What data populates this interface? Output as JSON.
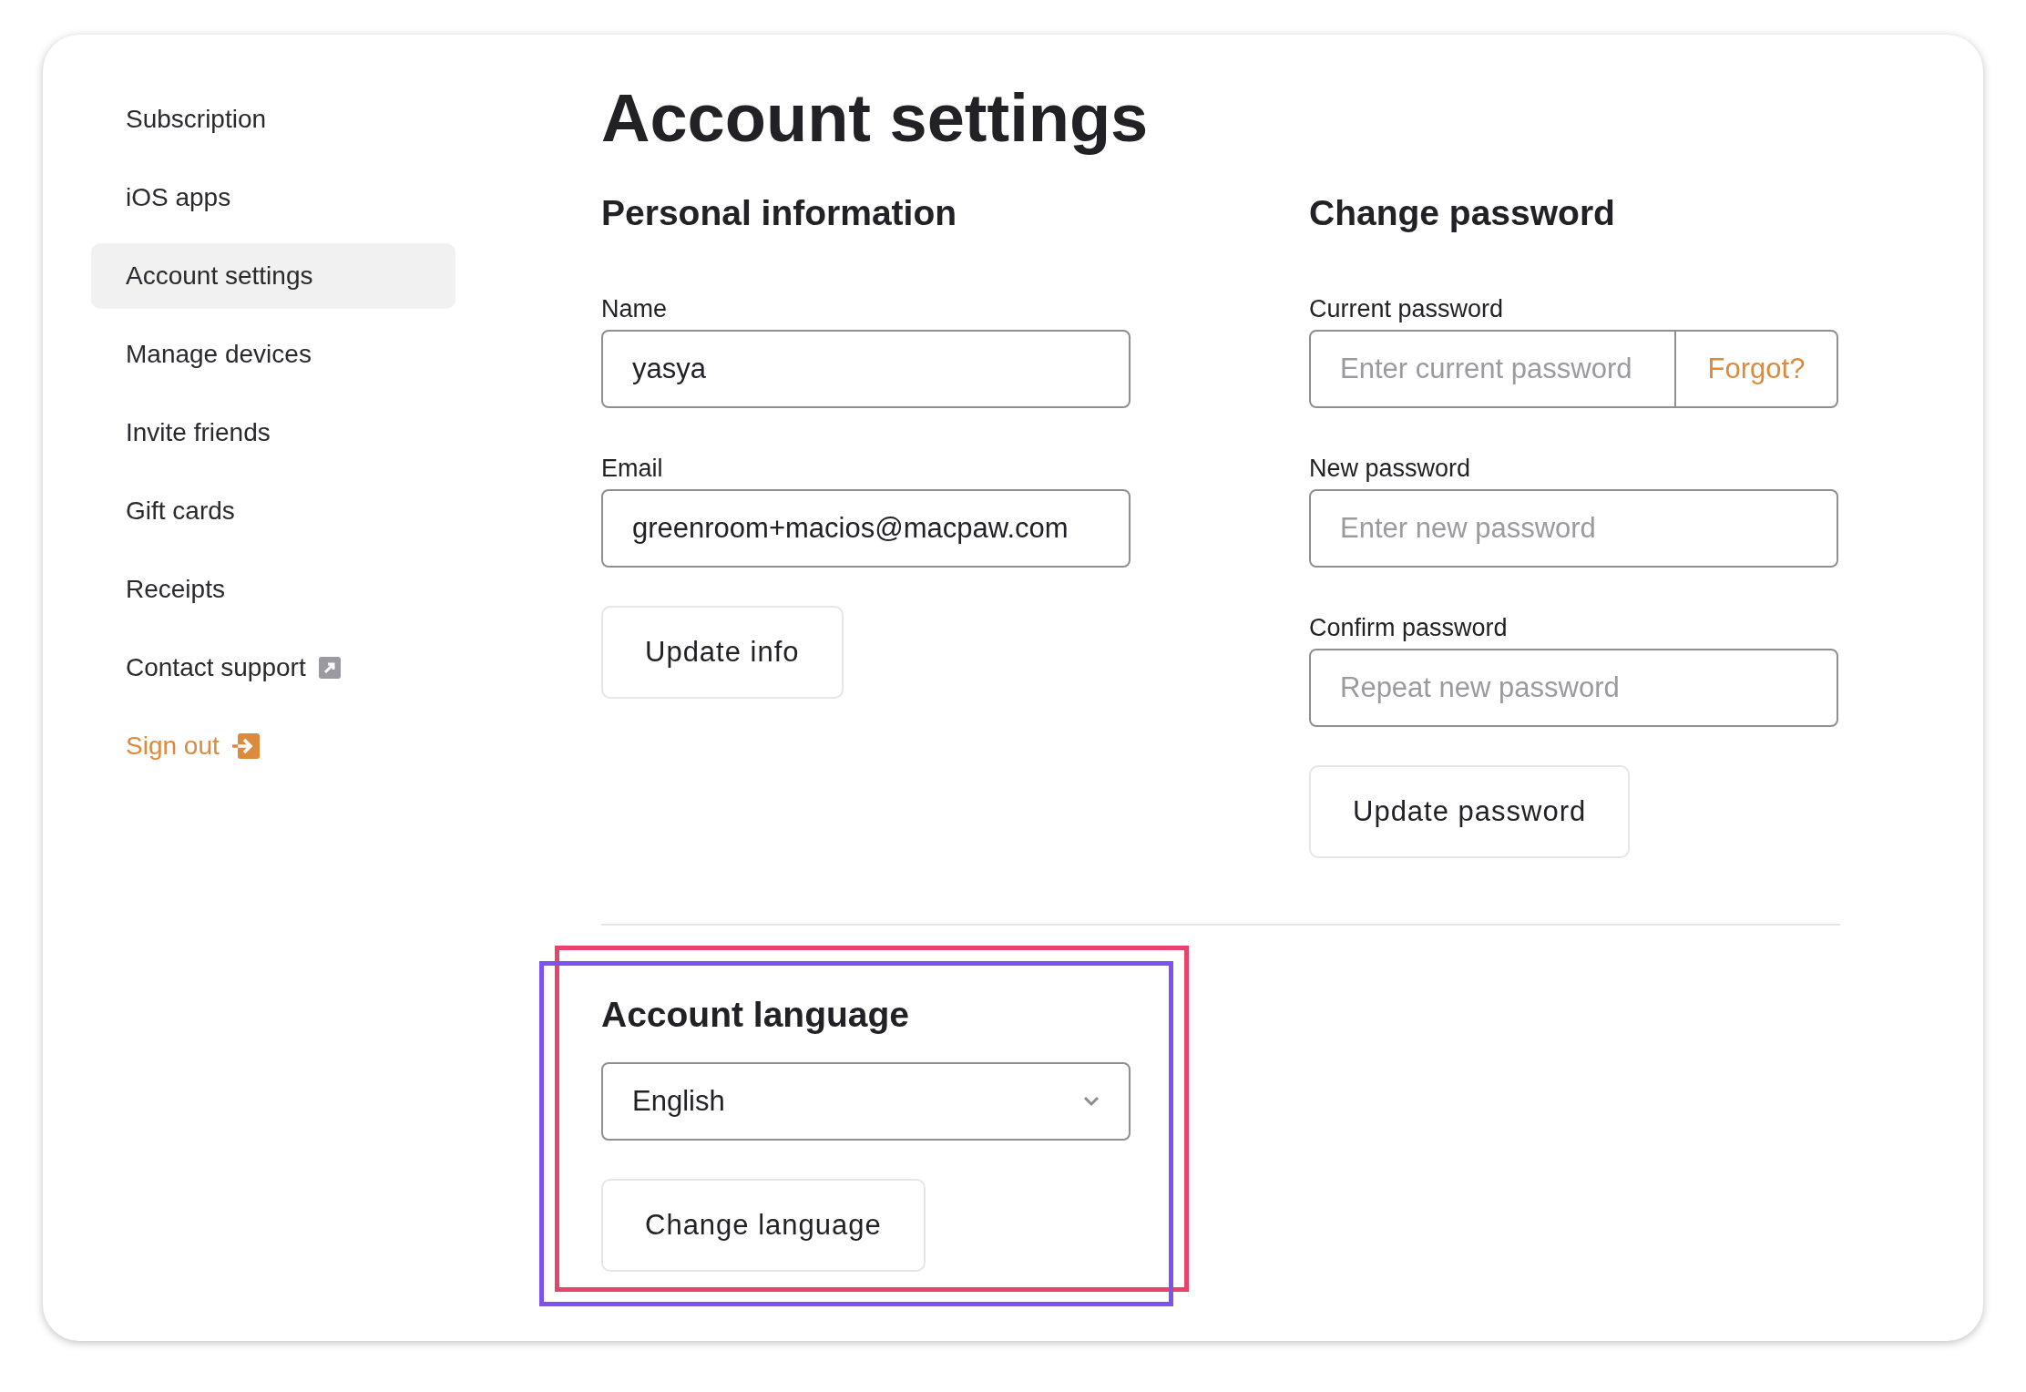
{
  "sidebar": {
    "items": [
      {
        "label": "Subscription",
        "selected": false,
        "kind": "plain"
      },
      {
        "label": "iOS apps",
        "selected": false,
        "kind": "plain"
      },
      {
        "label": "Account settings",
        "selected": true,
        "kind": "plain"
      },
      {
        "label": "Manage devices",
        "selected": false,
        "kind": "plain"
      },
      {
        "label": "Invite friends",
        "selected": false,
        "kind": "plain"
      },
      {
        "label": "Gift cards",
        "selected": false,
        "kind": "plain"
      },
      {
        "label": "Receipts",
        "selected": false,
        "kind": "plain"
      },
      {
        "label": "Contact support",
        "selected": false,
        "kind": "external"
      },
      {
        "label": "Sign out",
        "selected": false,
        "kind": "signout"
      }
    ]
  },
  "page": {
    "title": "Account settings"
  },
  "personal_information": {
    "heading": "Personal information",
    "fields": [
      {
        "label": "Name",
        "value": "yasya"
      },
      {
        "label": "Email",
        "value": "greenroom+macios@macpaw.com"
      }
    ],
    "button": "Update info"
  },
  "change_password": {
    "heading": "Change password",
    "fields": [
      {
        "label": "Current password",
        "placeholder": "Enter current password",
        "link": "Forgot?"
      },
      {
        "label": "New password",
        "placeholder": "Enter new password"
      },
      {
        "label": "Confirm password",
        "placeholder": "Repeat new password"
      }
    ],
    "button": "Update password"
  },
  "account_language": {
    "heading": "Account language",
    "value": "English",
    "button": "Change language"
  },
  "highlights": [
    {
      "color": "#e8436b"
    },
    {
      "color": "#7d52f0"
    }
  ]
}
